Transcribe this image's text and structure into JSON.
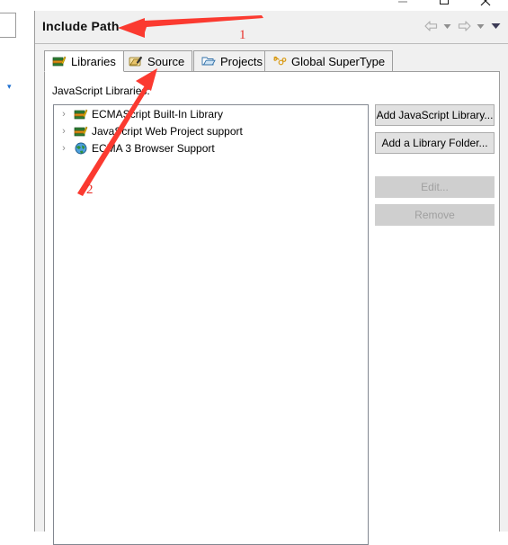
{
  "window": {
    "controls": [
      {
        "name": "minimize",
        "glyph": "minimize-icon"
      },
      {
        "name": "maximize",
        "glyph": "maximize-icon"
      },
      {
        "name": "close",
        "glyph": "close-icon"
      }
    ]
  },
  "panel": {
    "title": "Include Path",
    "toolbar": {
      "back_label": "Back",
      "back_menu_label": "Back history",
      "forward_label": "Forward",
      "forward_menu_label": "Forward history",
      "view_menu_label": "View menu"
    }
  },
  "tabs": [
    {
      "label": "Libraries",
      "icon": "books-library-icon",
      "selected": true
    },
    {
      "label": "Source",
      "icon": "source-folder-pencil-icon",
      "selected": false
    },
    {
      "label": "Projects",
      "icon": "open-folder-icon",
      "selected": false
    },
    {
      "label": "Global SuperType",
      "icon": "supertype-icon",
      "selected": false
    }
  ],
  "content": {
    "libraries_label": "JavaScript Libraries:",
    "tree_items": [
      {
        "label": "ECMAScript Built-In Library",
        "icon": "books-library-icon",
        "expander": "›"
      },
      {
        "label": "JavaScript Web Project support",
        "icon": "books-library-icon",
        "expander": "›"
      },
      {
        "label": "ECMA 3 Browser Support",
        "icon": "globe-icon",
        "expander": "›"
      }
    ]
  },
  "buttons": [
    {
      "label": "Add JavaScript Library...",
      "name": "add-javascript-library-button",
      "disabled": false
    },
    {
      "label": "Add a Library Folder...",
      "name": "add-library-folder-button",
      "disabled": false
    },
    {
      "label": "Edit...",
      "name": "edit-button",
      "disabled": true
    },
    {
      "label": "Remove",
      "name": "remove-button",
      "disabled": true
    }
  ],
  "annotations": [
    {
      "id": "1",
      "label": "1",
      "target": "Include Path title",
      "color": "#e8312a"
    },
    {
      "id": "2",
      "label": "2",
      "target": "Source tab",
      "color": "#e8312a"
    }
  ],
  "colors": {
    "panel_bg": "#f0f0f0",
    "content_bg": "#ffffff",
    "border": "#9e9e9e",
    "button_bg": "#e1e1e1",
    "button_disabled_bg": "#cfcfcf",
    "annotation_red": "#e8312a"
  }
}
